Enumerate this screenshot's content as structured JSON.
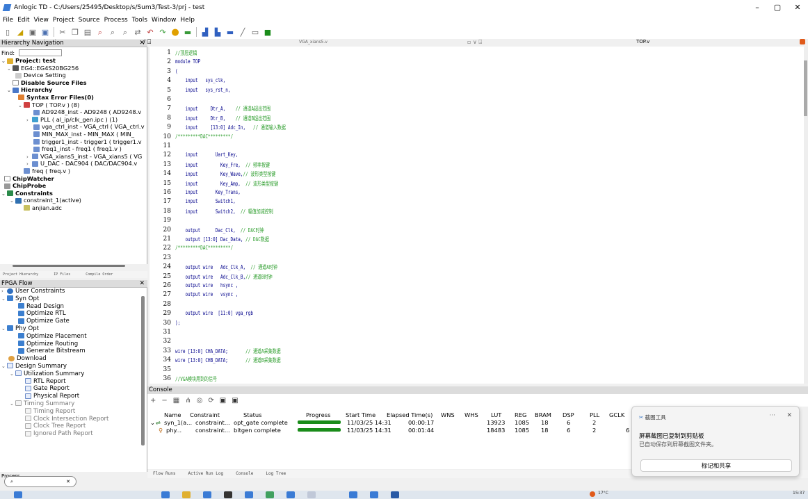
{
  "window": {
    "title": "Anlogic TD - C:/Users/25495/Desktop/s/Sum3/Test-3/prj - test"
  },
  "menu": [
    "File",
    "Edit",
    "View",
    "Project",
    "Source",
    "Process",
    "Tools",
    "Window",
    "Help"
  ],
  "hierarchy": {
    "header": "Hierarchy Navigation",
    "find_label": "Find:",
    "items": [
      "Project: test",
      "EG4::EG4S20BG256",
      "Device Setting",
      "Disable Source Files",
      "Hierarchy",
      "Syntax Error Files(0)",
      "TOP ( TOP.v )  (8)",
      "AD9248_inst - AD9248 ( AD9248.v",
      "PLL ( al_ip/clk_gen.ipc ) (1)",
      "vga_ctrl_inst - VGA_ctrl ( VGA_ctrl.v",
      "MIN_MAX_inst - MIN_MAX ( MIN_",
      "trigger1_inst - trigger1 ( trigger1.v",
      "freq1_inst - freq1 ( freq1.v )",
      "VGA_xians5_inst - VGA_xians5 ( VG",
      "U_DAC - DAC904 ( DAC/DAC904.v",
      "freq ( freq.v )",
      "ChipWatcher",
      "ChipProbe",
      "Constraints",
      "constraint_1(active)",
      "anjian.adc"
    ],
    "tabs": [
      "Project Hierarchy",
      "IP Files",
      "Compile Order"
    ]
  },
  "flow": {
    "header": "FPGA Flow",
    "items": [
      "User Constraints",
      "Syn Opt",
      "Read Design",
      "Optimize RTL",
      "Optimize Gate",
      "Phy Opt",
      "Optimize Placement",
      "Optimize Routing",
      "Generate Bitstream",
      "Download",
      "Design Summary",
      "Utilization Summary",
      "RTL Report",
      "Gate Report",
      "Physical Report",
      "Timing Summary",
      "Timing Report",
      "Clock Intersection Report",
      "Clock Tree Report",
      "Ignored Path Report"
    ]
  },
  "editor": {
    "tab_left": "VGA_xians5.v",
    "tab_right": "TOP.v",
    "lines": [
      "//顶层逻辑",
      "module TOP",
      "(",
      "    input   sys_clk,",
      "    input   sys_rst_n,",
      "",
      "    input     Dtr_A,    // 通道A超出范围",
      "    input     Dtr_B,    // 通道B超出范围",
      "    input     [13:0] Adc_In,   // 通道输入数据",
      "/*********DAC*********/",
      "",
      "    input       Uart_Key,",
      "    input         Key_Fre,  // 频率按键",
      "    input         Key_Wave,// 波形类型按键",
      "    input         Key_Amp,  // 波形类型按键",
      "    input       Key_Trans,",
      "    input       Switch1,",
      "    input       Switch2,  // 幅值加减控制",
      "",
      "    output      Dac_Clk,  // DAC时钟",
      "    output [13:0] Dac_Data, // DAC数据",
      "/*********DAC*********/",
      "",
      "    output wire   Adc_Clk_A,  // 通道A时钟",
      "    output wire   Adc_Clk_B,// 通道B时钟",
      "    output wire   hsync ,",
      "    output wire   vsync ,",
      "",
      "    output wire  [11:0] vga_rgb",
      ");",
      "",
      "",
      "wire [13:0] CHA_DATA;       // 通道A采集数据",
      "wire [13:0] CHB_DATA;       // 通道B采集数据",
      "",
      "//VGA模块用到的信号"
    ]
  },
  "console": {
    "header": "Console",
    "columns": [
      "Name",
      "Constraint",
      "Status",
      "Progress",
      "Start Time",
      "Elapsed Time(s)",
      "WNS",
      "WHS",
      "LUT",
      "REG",
      "BRAM",
      "DSP",
      "PLL",
      "GCLK"
    ],
    "rows": [
      {
        "name": "syn_1(a...",
        "constraint": "constraint...",
        "status": "opt_gate complete",
        "start": "11/03/25 14:31",
        "elapsed": "00:00:17",
        "lut": "13923",
        "reg": "1085",
        "bram": "18",
        "dsp": "6",
        "pll": "2",
        "progress": 1.0
      },
      {
        "name": "phy...",
        "constraint": "constraint...",
        "status": "bitgen complete",
        "start": "11/03/25 14:31",
        "elapsed": "00:01:44",
        "lut": "18483",
        "reg": "1085",
        "bram": "18",
        "dsp": "6",
        "pll": "2",
        "gclk": "6",
        "progress": 1.0
      }
    ],
    "tabs": [
      "Flow Runs",
      "Active Run Log",
      "Console",
      "Log Tree"
    ]
  },
  "notification": {
    "app": "截图工具",
    "title": "屏幕截图已复制到剪贴板",
    "message": "已自动保存到屏幕截图文件夹。",
    "button": "标记和共享"
  },
  "taskbar": {
    "process_label": "Process",
    "temp": "17°C",
    "clock": "15:37"
  }
}
